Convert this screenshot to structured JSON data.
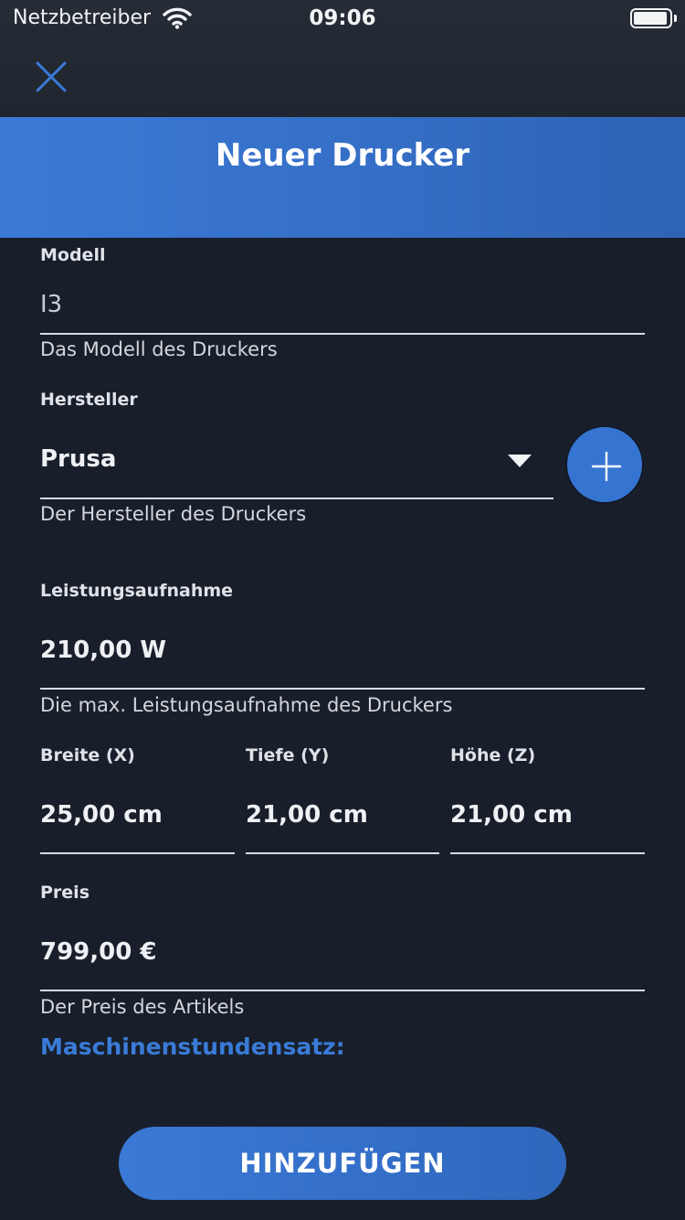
{
  "status_bar": {
    "carrier": "Netzbetreiber",
    "time": "09:06"
  },
  "icons": {
    "close": "close-icon",
    "wifi": "wifi-icon",
    "battery": "battery-icon",
    "dropdown": "triangle-down-icon",
    "add": "plus-icon"
  },
  "header": {
    "title": "Neuer Drucker"
  },
  "form": {
    "model": {
      "label": "Modell",
      "value": "I3",
      "hint": "Das Modell des Druckers"
    },
    "manufacturer": {
      "label": "Hersteller",
      "value": "Prusa",
      "hint": "Der Hersteller des Druckers"
    },
    "power": {
      "label": "Leistungsaufnahme",
      "value": "210,00 W",
      "hint": "Die max. Leistungsaufnahme des Druckers"
    },
    "width": {
      "label": "Breite (X)",
      "value": "25,00 cm"
    },
    "depth": {
      "label": "Tiefe (Y)",
      "value": "21,00 cm"
    },
    "height": {
      "label": "Höhe (Z)",
      "value": "21,00 cm"
    },
    "price": {
      "label": "Preis",
      "value": "799,00 €",
      "hint": "Der Preis des Artikels"
    },
    "machine_rate_label": "Maschinenstundensatz:",
    "submit_label": "HINZUFÜGEN"
  },
  "colors": {
    "background": "#181f2b",
    "accent": "#3a7bd8",
    "header": "#3575d1"
  }
}
